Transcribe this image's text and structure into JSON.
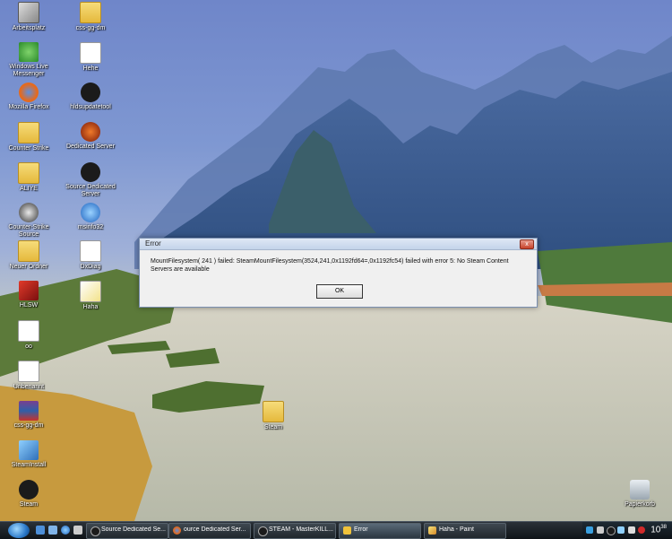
{
  "desktop": {
    "icons": [
      {
        "label": "Arbeitsplatz",
        "icon": "computer-icon"
      },
      {
        "label": "css-gg-dm",
        "icon": "folder-icon"
      },
      {
        "label": "Windows Live Messenger",
        "icon": "messenger-icon"
      },
      {
        "label": "Hehe",
        "icon": "document-icon"
      },
      {
        "label": "Mozilla Firefox",
        "icon": "firefox-icon"
      },
      {
        "label": "hldsupdatetool",
        "icon": "steam-icon"
      },
      {
        "label": "Counter Strike",
        "icon": "folder-icon"
      },
      {
        "label": "Dedicated Server",
        "icon": "halflife-icon"
      },
      {
        "label": "ALIYE",
        "icon": "folder-icon"
      },
      {
        "label": "Source Dedicated Server",
        "icon": "steam-icon"
      },
      {
        "label": "Counter-Strike Source",
        "icon": "counterstrike-icon"
      },
      {
        "label": "msinfo32",
        "icon": "info-icon"
      },
      {
        "label": "Neuer Ordner",
        "icon": "folder-icon"
      },
      {
        "label": "DxDiag",
        "icon": "document-icon"
      },
      {
        "label": "HLSW",
        "icon": "hlsw-icon"
      },
      {
        "label": "Haha",
        "icon": "paint-document-icon"
      },
      {
        "label": "oo",
        "icon": "document-icon"
      },
      {
        "label": "Unbenannt",
        "icon": "document-icon"
      },
      {
        "label": "css-gg-dm",
        "icon": "winrar-icon"
      },
      {
        "label": "SteamInstall",
        "icon": "installer-icon"
      },
      {
        "label": "Steam",
        "icon": "steam-icon"
      },
      {
        "label": "Steam",
        "icon": "folder-icon"
      },
      {
        "label": "Papierkorb",
        "icon": "recycle-bin-icon"
      }
    ]
  },
  "dialog": {
    "title": "Error",
    "close_label": "x",
    "message": "MountFilesystem( 241 ) failed: SteamMountFilesystem(3524,241,0x1192fd64=,0x1192fc54) failed with error 5: No Steam Content Servers are available",
    "ok_label": "OK"
  },
  "taskbar": {
    "tasks": [
      {
        "label": "Source Dedicated Se...",
        "icon": "steam-icon"
      },
      {
        "label": "ource Dedicated Ser...",
        "icon": "firefox-icon"
      },
      {
        "label": "STEAM - MasterKILL...",
        "icon": "steam-icon"
      },
      {
        "label": "Error",
        "icon": "warning-icon"
      },
      {
        "label": "Haha - Paint",
        "icon": "paint-icon"
      }
    ],
    "clock": {
      "hour": "10",
      "minute": "38"
    }
  }
}
